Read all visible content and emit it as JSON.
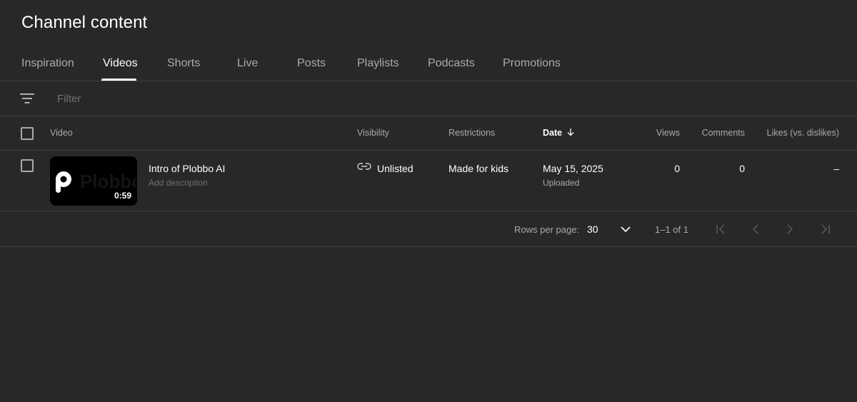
{
  "page": {
    "title": "Channel content"
  },
  "tabs": [
    {
      "label": "Inspiration",
      "active": false
    },
    {
      "label": "Videos",
      "active": true
    },
    {
      "label": "Shorts",
      "active": false
    },
    {
      "label": "Live",
      "active": false
    },
    {
      "label": "Posts",
      "active": false
    },
    {
      "label": "Playlists",
      "active": false
    },
    {
      "label": "Podcasts",
      "active": false
    },
    {
      "label": "Promotions",
      "active": false
    }
  ],
  "filter": {
    "placeholder": "Filter",
    "value": "",
    "icon": "filter-icon"
  },
  "table": {
    "columns": {
      "video": "Video",
      "visibility": "Visibility",
      "restrictions": "Restrictions",
      "date": "Date",
      "views": "Views",
      "comments": "Comments",
      "likes": "Likes (vs. dislikes)"
    },
    "sort": {
      "column": "date",
      "direction": "descending",
      "icon": "arrow-down-icon"
    },
    "rows": [
      {
        "title": "Intro of Plobbo AI",
        "description": "Add description",
        "thumbnail": {
          "wordmark": "Plobbo",
          "duration": "0:59",
          "logo_icon": "plobbo-logo-icon"
        },
        "visibility": {
          "label": "Unlisted",
          "icon": "link-icon"
        },
        "restrictions": "Made for kids",
        "date": "May 15, 2025",
        "date_status": "Uploaded",
        "views": "0",
        "comments": "0",
        "likes": "–"
      }
    ]
  },
  "pagination": {
    "rows_per_page_label": "Rows per page:",
    "rows_per_page": "30",
    "range": "1–1 of 1"
  },
  "colors": {
    "background": "#282828",
    "divider": "#3f3f3f",
    "text_primary": "#ffffff",
    "text_secondary": "#aaaaaa",
    "text_muted": "#717171"
  }
}
